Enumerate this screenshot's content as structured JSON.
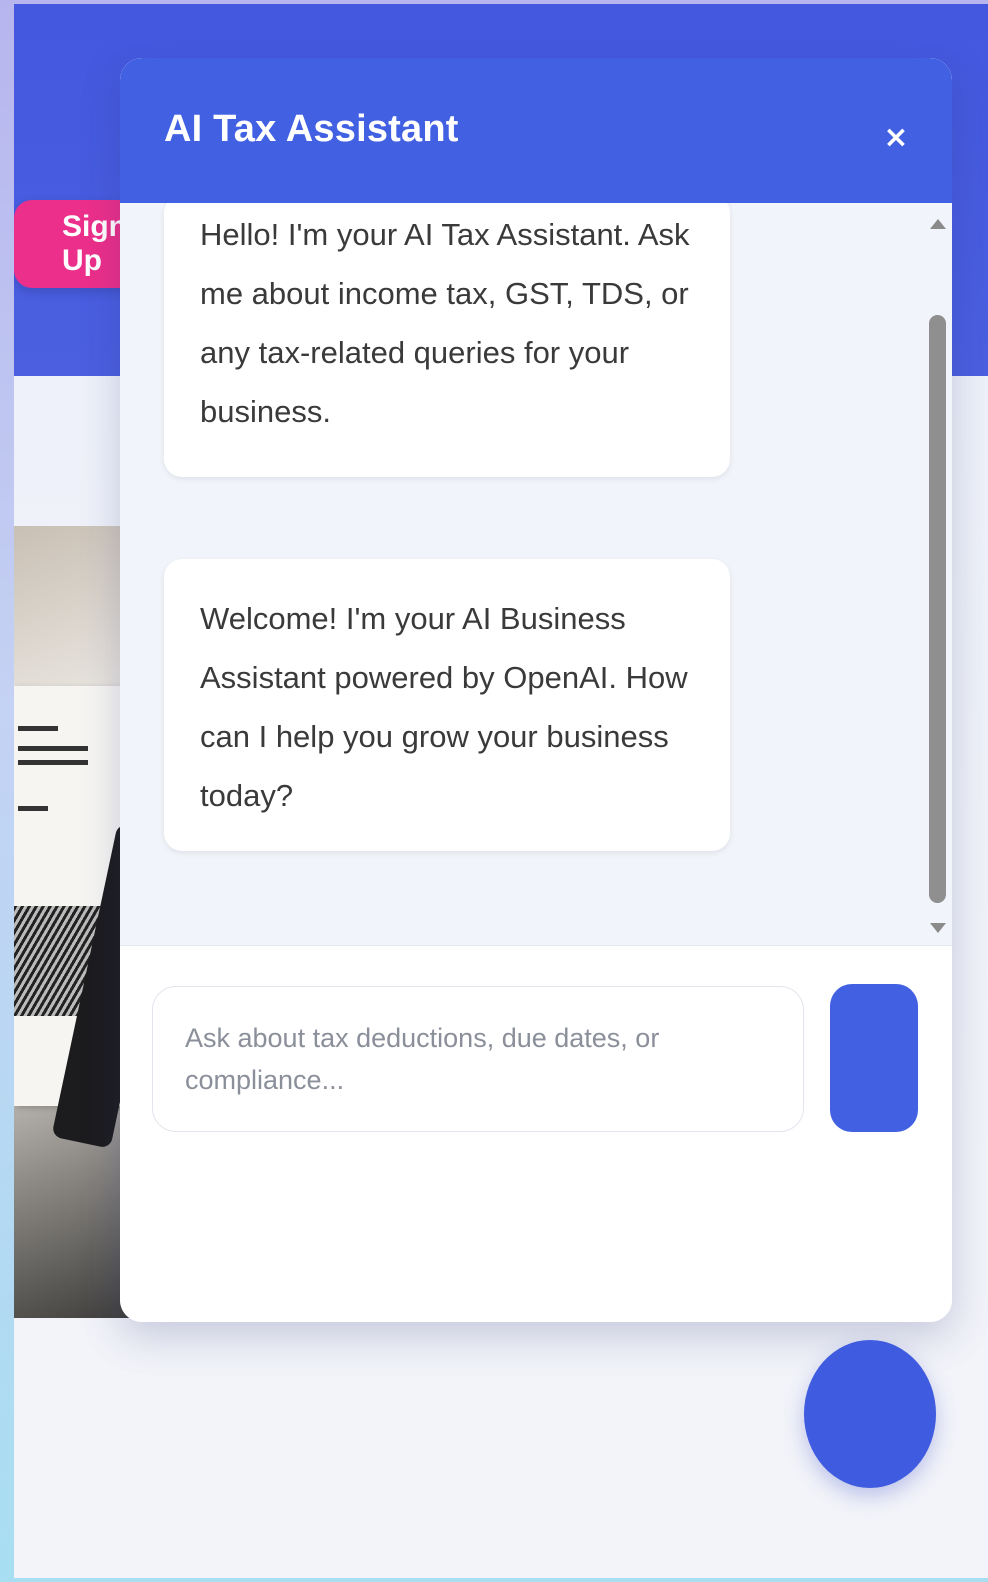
{
  "page": {
    "signup_label": "Sign Up"
  },
  "chat": {
    "title": "AI Tax Assistant",
    "close_label": "×",
    "messages": [
      {
        "role": "assistant",
        "text": "Hello! I'm your AI Tax Assistant. Ask me about income tax, GST, TDS, or any tax-related queries for your business."
      },
      {
        "role": "assistant",
        "text": "Welcome! I'm your AI Business Assistant powered by OpenAI. How can I help you grow your business today?"
      }
    ],
    "input": {
      "value": "",
      "placeholder": "Ask about tax deductions, due dates, or compliance..."
    },
    "send_label": ""
  },
  "colors": {
    "accent": "#4260e2",
    "signup": "#ec2f8a",
    "header_bg": "#4358df"
  },
  "icons": {
    "close": "close-icon",
    "scroll_up": "arrow-up-icon",
    "scroll_down": "arrow-down-icon"
  }
}
